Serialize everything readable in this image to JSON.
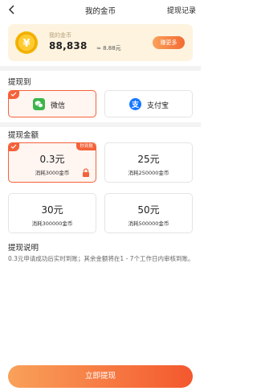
{
  "header": {
    "title": "我的金币",
    "history_label": "提现记录"
  },
  "balance": {
    "label": "我的金币",
    "amount": "88,838",
    "approx_value": "≈ 8.88元",
    "earn_more_label": "赚更多"
  },
  "withdraw_to": {
    "title": "提现到",
    "methods": [
      {
        "label": "微信",
        "icon": "wechat-icon",
        "selected": true
      },
      {
        "label": "支付宝",
        "icon": "alipay-icon",
        "selected": false
      }
    ]
  },
  "withdraw_amount": {
    "title": "提现金额",
    "options": [
      {
        "value": "0.3元",
        "cost": "消耗3000金币",
        "selected": true,
        "tag": "秒到账",
        "locked": true
      },
      {
        "value": "25元",
        "cost": "消耗250000金币",
        "selected": false
      },
      {
        "value": "30元",
        "cost": "消耗300000金币",
        "selected": false
      },
      {
        "value": "50元",
        "cost": "消耗500000金币",
        "selected": false
      }
    ]
  },
  "explain": {
    "title": "提现说明",
    "text": "0.3元申请成功后实时到账；其余金额将在1 - 7个工作日内审核到账。"
  },
  "footer": {
    "button_label": "立即提现"
  },
  "colors": {
    "accent": "#f4623a",
    "wechat_green": "#3bb54a",
    "alipay_blue": "#1677ff",
    "coin_gold": "#f5b400"
  }
}
